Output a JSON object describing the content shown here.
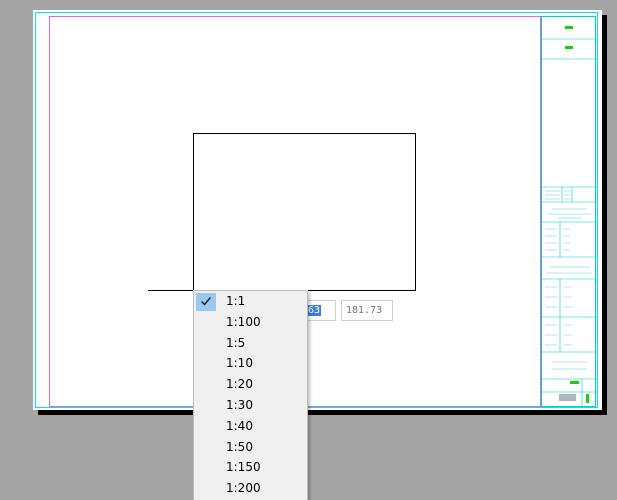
{
  "coordinates": {
    "x_value": ".63",
    "y_value": "181.73"
  },
  "scale_menu": {
    "selected": "1:1",
    "items": [
      "1:1",
      "1:100",
      "1:5",
      "1:10",
      "1:20",
      "1:30",
      "1:40",
      "1:50",
      "1:150",
      "1:200"
    ]
  },
  "colors": {
    "workspace": "#a4a4a4",
    "sheet_border": "#00e6e6",
    "frame_border": "#e066e0",
    "title_accent": "#19cc19",
    "selection": "#3a7fe0",
    "check_highlight": "#99c9ef"
  },
  "icons": {
    "selected_marker": "checkmark-icon"
  }
}
